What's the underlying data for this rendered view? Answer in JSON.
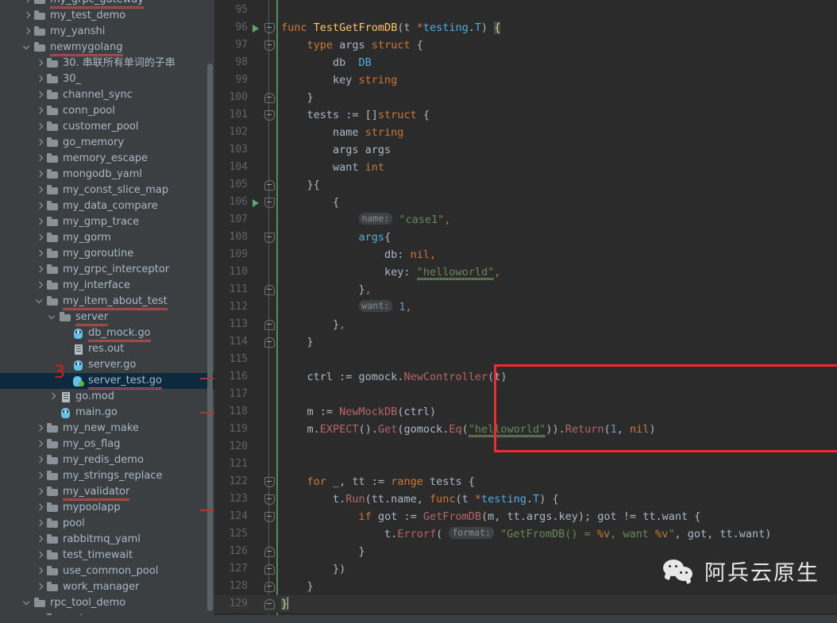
{
  "sidebar": {
    "scrollbar": "vertical-scrollbar",
    "annotation": "3",
    "items": [
      {
        "label": "my_grpc_gateway",
        "indent": 1,
        "type": "folder",
        "arrow": "closed",
        "clipped": true,
        "squiggle": true
      },
      {
        "label": "my_test_demo",
        "indent": 1,
        "type": "folder",
        "arrow": "closed"
      },
      {
        "label": "my_yanshi",
        "indent": 1,
        "type": "folder",
        "arrow": "closed"
      },
      {
        "label": "newmygolang",
        "indent": 1,
        "type": "folder",
        "arrow": "open",
        "squiggle": true
      },
      {
        "label": "30. 串联所有单词的子串",
        "indent": 2,
        "type": "folder",
        "arrow": "closed"
      },
      {
        "label": "30_",
        "indent": 2,
        "type": "folder",
        "arrow": "closed"
      },
      {
        "label": "channel_sync",
        "indent": 2,
        "type": "folder",
        "arrow": "closed"
      },
      {
        "label": "conn_pool",
        "indent": 2,
        "type": "folder",
        "arrow": "closed"
      },
      {
        "label": "customer_pool",
        "indent": 2,
        "type": "folder",
        "arrow": "closed"
      },
      {
        "label": "go_memory",
        "indent": 2,
        "type": "folder",
        "arrow": "closed"
      },
      {
        "label": "memory_escape",
        "indent": 2,
        "type": "folder",
        "arrow": "closed"
      },
      {
        "label": "mongodb_yaml",
        "indent": 2,
        "type": "folder",
        "arrow": "closed"
      },
      {
        "label": "my_const_slice_map",
        "indent": 2,
        "type": "folder",
        "arrow": "closed"
      },
      {
        "label": "my_data_compare",
        "indent": 2,
        "type": "folder",
        "arrow": "closed"
      },
      {
        "label": "my_gmp_trace",
        "indent": 2,
        "type": "folder",
        "arrow": "closed"
      },
      {
        "label": "my_gorm",
        "indent": 2,
        "type": "folder",
        "arrow": "closed"
      },
      {
        "label": "my_goroutine",
        "indent": 2,
        "type": "folder",
        "arrow": "closed"
      },
      {
        "label": "my_grpc_interceptor",
        "indent": 2,
        "type": "folder",
        "arrow": "closed"
      },
      {
        "label": "my_interface",
        "indent": 2,
        "type": "folder",
        "arrow": "closed"
      },
      {
        "label": "my_item_about_test",
        "indent": 2,
        "type": "folder",
        "arrow": "open",
        "squiggle": true
      },
      {
        "label": "server",
        "indent": 3,
        "type": "folder",
        "arrow": "open",
        "squiggle": true
      },
      {
        "label": "db_mock.go",
        "indent": 4,
        "type": "go",
        "arrow": "none",
        "squiggle": true
      },
      {
        "label": "res.out",
        "indent": 4,
        "type": "txt",
        "arrow": "none"
      },
      {
        "label": "server.go",
        "indent": 4,
        "type": "go",
        "arrow": "none"
      },
      {
        "label": "server_test.go",
        "indent": 4,
        "type": "gotest",
        "arrow": "none",
        "selected": true,
        "squiggle": true
      },
      {
        "label": "go.mod",
        "indent": 3,
        "type": "txt",
        "arrow": "closed"
      },
      {
        "label": "main.go",
        "indent": 3,
        "type": "go",
        "arrow": "none"
      },
      {
        "label": "my_new_make",
        "indent": 2,
        "type": "folder",
        "arrow": "closed"
      },
      {
        "label": "my_os_flag",
        "indent": 2,
        "type": "folder",
        "arrow": "closed"
      },
      {
        "label": "my_redis_demo",
        "indent": 2,
        "type": "folder",
        "arrow": "closed"
      },
      {
        "label": "my_strings_replace",
        "indent": 2,
        "type": "folder",
        "arrow": "closed"
      },
      {
        "label": "my_validator",
        "indent": 2,
        "type": "folder",
        "arrow": "closed",
        "squiggle": true
      },
      {
        "label": "mypoolapp",
        "indent": 2,
        "type": "folder",
        "arrow": "closed"
      },
      {
        "label": "pool",
        "indent": 2,
        "type": "folder",
        "arrow": "closed"
      },
      {
        "label": "rabbitmq_yaml",
        "indent": 2,
        "type": "folder",
        "arrow": "closed"
      },
      {
        "label": "test_timewait",
        "indent": 2,
        "type": "folder",
        "arrow": "closed"
      },
      {
        "label": "use_common_pool",
        "indent": 2,
        "type": "folder",
        "arrow": "closed"
      },
      {
        "label": "work_manager",
        "indent": 2,
        "type": "folder",
        "arrow": "closed"
      },
      {
        "label": "rpc_tool_demo",
        "indent": 1,
        "type": "folder",
        "arrow": "open"
      },
      {
        "label": "protoc",
        "indent": 2,
        "type": "folder",
        "arrow": "closed"
      }
    ]
  },
  "editor": {
    "first_line_number": 95,
    "last_line_number": 129,
    "current_line": 129,
    "run_marker_lines": [
      96,
      106
    ],
    "lines": [
      {
        "n": 95,
        "text": ""
      },
      {
        "n": 96,
        "text": "func TestGetFromDB(t *testing.T) {",
        "fold": "top",
        "run": true
      },
      {
        "n": 97,
        "text": "    type args struct {",
        "fold": "top"
      },
      {
        "n": 98,
        "text": "        db  DB"
      },
      {
        "n": 99,
        "text": "        key string"
      },
      {
        "n": 100,
        "text": "    }",
        "fold": "bot"
      },
      {
        "n": 101,
        "text": "    tests := []struct {",
        "fold": "top"
      },
      {
        "n": 102,
        "text": "        name string"
      },
      {
        "n": 103,
        "text": "        args args"
      },
      {
        "n": 104,
        "text": "        want int"
      },
      {
        "n": 105,
        "text": "    }{",
        "fold": "bot"
      },
      {
        "n": 106,
        "text": "        {",
        "fold": "top",
        "run": true
      },
      {
        "n": 107,
        "text": "            name: \"case1\","
      },
      {
        "n": 108,
        "text": "            args{",
        "fold": "top"
      },
      {
        "n": 109,
        "text": "                db: nil,"
      },
      {
        "n": 110,
        "text": "                key: \"helloworld\","
      },
      {
        "n": 111,
        "text": "            },",
        "fold": "bot"
      },
      {
        "n": 112,
        "text": "            want: 1,"
      },
      {
        "n": 113,
        "text": "        },",
        "fold": "bot"
      },
      {
        "n": 114,
        "text": "    }",
        "fold": "bot"
      },
      {
        "n": 115,
        "text": ""
      },
      {
        "n": 116,
        "text": "    ctrl := gomock.NewController(t)"
      },
      {
        "n": 117,
        "text": ""
      },
      {
        "n": 118,
        "text": "    m := NewMockDB(ctrl)"
      },
      {
        "n": 119,
        "text": "    m.EXPECT().Get(gomock.Eq(\"helloworld\")).Return(1, nil)"
      },
      {
        "n": 120,
        "text": ""
      },
      {
        "n": 121,
        "text": ""
      },
      {
        "n": 122,
        "text": "    for _, tt := range tests {",
        "fold": "top"
      },
      {
        "n": 123,
        "text": "        t.Run(tt.name, func(t *testing.T) {",
        "fold": "top"
      },
      {
        "n": 124,
        "text": "            if got := GetFromDB(m, tt.args.key); got != tt.want {",
        "fold": "top"
      },
      {
        "n": 125,
        "text": "                t.Errorf( format: \"GetFromDB() = %v, want %v\", got, tt.want)"
      },
      {
        "n": 126,
        "text": "            }",
        "fold": "bot"
      },
      {
        "n": 127,
        "text": "        })",
        "fold": "bot"
      },
      {
        "n": 128,
        "text": "    }",
        "fold": "bot"
      },
      {
        "n": 129,
        "text": "}",
        "fold": "bot",
        "current": true
      }
    ],
    "inline_hints": [
      {
        "line": 107,
        "label": "name:"
      },
      {
        "line": 112,
        "label": "want:"
      },
      {
        "line": 125,
        "label": "format:"
      }
    ],
    "highlight_box": {
      "label": "red-highlight-box",
      "color": "#ef2b2b",
      "covers_lines": [
        116,
        117,
        118,
        119,
        120
      ]
    }
  },
  "watermark": {
    "text": "阿兵云原生",
    "icon": "wechat-icon",
    "color": "#e8e8e8"
  },
  "colors": {
    "editor_bg": "#2b2b2b",
    "sidebar_bg": "#3c3f41",
    "selection_bg": "#0d293e",
    "keyword": "#cc7832",
    "function": "#ffc66d",
    "string": "#6a8759",
    "number": "#6897bb",
    "builtin_type": "#4eade5",
    "method": "#b5656a",
    "linenumber": "#606366",
    "annotation_red": "#e01b1b"
  }
}
